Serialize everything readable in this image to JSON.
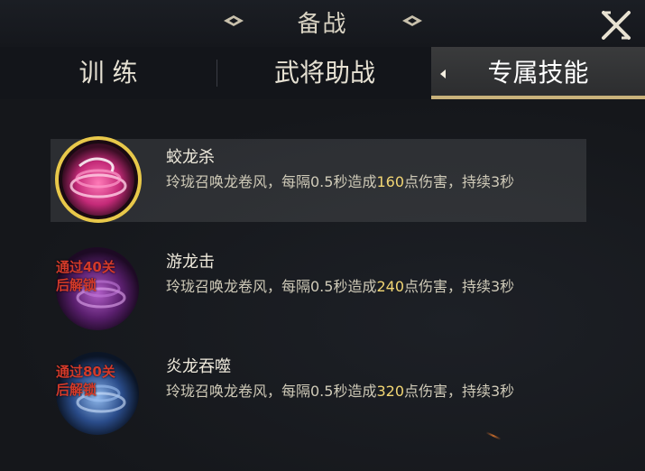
{
  "header": {
    "title": "备战",
    "close_icon": "close-x-icon"
  },
  "tabs": [
    {
      "label": "训 练",
      "active": false
    },
    {
      "label": "武将助战",
      "active": false
    },
    {
      "label": "专属技能",
      "active": true
    }
  ],
  "skills": [
    {
      "name": "蛟龙杀",
      "desc_prefix": "玲珑召唤龙卷风，每隔0.5秒造成",
      "damage": "160",
      "desc_suffix": "点伤害，持续3秒",
      "locked": false,
      "lock_text": "",
      "icon": "pink-dragon-vortex-icon",
      "color": "#e0458a"
    },
    {
      "name": "游龙击",
      "desc_prefix": "玲珑召唤龙卷风，每隔0.5秒造成",
      "damage": "240",
      "desc_suffix": "点伤害，持续3秒",
      "locked": true,
      "lock_text": "通过40关后解锁",
      "icon": "purple-dragon-vortex-icon",
      "color": "#8a3a9a"
    },
    {
      "name": "炎龙吞噬",
      "desc_prefix": "玲珑召唤龙卷风，每隔0.5秒造成",
      "damage": "320",
      "desc_suffix": "点伤害，持续3秒",
      "locked": true,
      "lock_text": "通过80关后解锁",
      "icon": "blue-dragon-vortex-icon",
      "color": "#3a66b0"
    }
  ],
  "colors": {
    "highlight": "#f2d674",
    "selected_ring": "#e8c84a",
    "lock_text": "#d33a2a"
  }
}
